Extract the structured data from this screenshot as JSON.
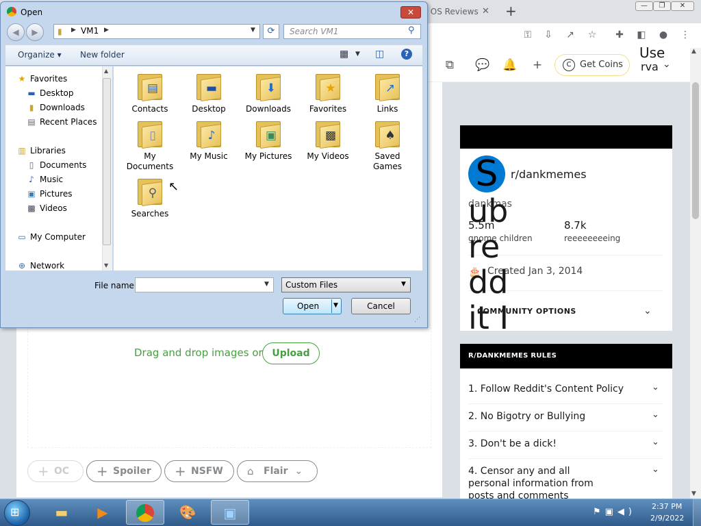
{
  "chrome": {
    "bg_tab_title": "r OS Reviews",
    "tab_close": "✕",
    "new_tab": "+",
    "win_min": "—",
    "win_max": "❐",
    "win_close": "✕"
  },
  "reddit": {
    "get_coins": "Get Coins",
    "user_label_line1": "Use",
    "user_label_line2": "rva",
    "drop_text": "Drag and drop images or",
    "upload": "Upload",
    "tags": {
      "oc": "OC",
      "spoiler": "Spoiler",
      "nsfw": "NSFW",
      "flair": "Flair"
    },
    "community": {
      "avatar_letter": "S",
      "name": "r/dankmemes",
      "description": "dankmas",
      "stat1_value": "5.5m",
      "stat1_label": "gnome children",
      "stat2_value": "8.7k",
      "stat2_label": "reeeeeeeeing",
      "created": "Created Jan 3, 2014",
      "options": "COMMUNITY OPTIONS",
      "vertical_text": "ubreddit Ico"
    },
    "rules_header": "R/DANKMEMES RULES",
    "rules": [
      "1. Follow Reddit's Content Policy",
      "2. No Bigotry or Bullying",
      "3. Don't be a dick!",
      "4. Censor any and all personal information from posts and comments"
    ]
  },
  "dialog": {
    "title": "Open",
    "address_folder": "VM1",
    "search_placeholder": "Search VM1",
    "organize": "Organize ▾",
    "new_folder": "New folder",
    "nav": {
      "favorites": "Favorites",
      "desktop": "Desktop",
      "downloads": "Downloads",
      "recent_places": "Recent Places",
      "libraries": "Libraries",
      "documents": "Documents",
      "music": "Music",
      "pictures": "Pictures",
      "videos": "Videos",
      "my_computer": "My Computer",
      "network": "Network"
    },
    "items": [
      "Contacts",
      "Desktop",
      "Downloads",
      "Favorites",
      "Links",
      "My Documents",
      "My Music",
      "My Pictures",
      "My Videos",
      "Saved Games",
      "Searches"
    ],
    "file_name_label": "File name:",
    "file_name_value": "",
    "file_type": "Custom Files",
    "open_button": "Open",
    "cancel_button": "Cancel"
  },
  "taskbar": {
    "time": "2:37 PM",
    "date": "2/9/2022"
  },
  "colors": {
    "reddit_green": "#46a040",
    "dialog_frame": "#c5d7ec",
    "taskbar": "#2f5a89"
  }
}
